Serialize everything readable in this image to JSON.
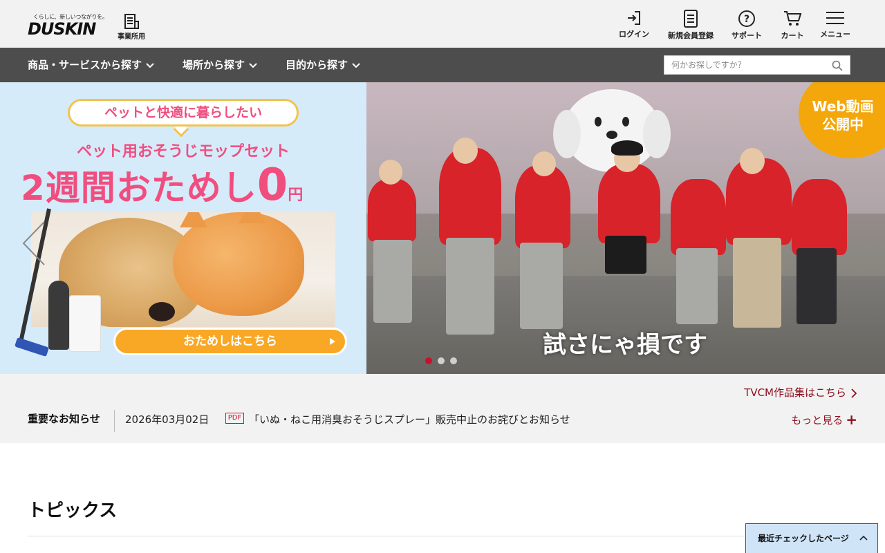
{
  "header": {
    "logo_tagline": "くらしに、新しいつながりを。",
    "logo_word": "DUSKIN",
    "business_label": "事業所用",
    "utility": [
      {
        "label": "ログイン",
        "icon": "login-icon"
      },
      {
        "label": "新規会員登録",
        "icon": "register-icon"
      },
      {
        "label": "サポート",
        "icon": "help-icon"
      },
      {
        "label": "カート",
        "icon": "cart-icon"
      },
      {
        "label": "メニュー",
        "icon": "menu-icon"
      }
    ]
  },
  "nav": {
    "items": [
      {
        "label": "商品・サービスから探す"
      },
      {
        "label": "場所から探す"
      },
      {
        "label": "目的から探す"
      }
    ],
    "search_placeholder": "何かお探しですか？"
  },
  "hero": {
    "promo": {
      "bubble": "ペットと快適に暮らしたい",
      "subtitle": "ペット用おそうじモップセット",
      "headline": "2週間おためし",
      "headline_zero": "0",
      "headline_yen": "円",
      "cta": "おためしはこちら"
    },
    "video": {
      "caption": "試さにゃ損です",
      "badge_line1": "Web動画",
      "badge_line2": "公開中"
    },
    "active_slide": 1,
    "slide_count": 3
  },
  "notice": {
    "tvcm_link": "TVCM作品集はこちら",
    "label": "重要なお知らせ",
    "date": "2026年03月02日",
    "pdf": "PDF",
    "title": "「いぬ・ねこ用消臭おそうじスプレー」販売中止のお詫びとお知らせ",
    "more": "もっと見る",
    "more_plus": "+"
  },
  "topics": {
    "title": "トピックス"
  },
  "recent": {
    "label": "最近チェックしたページ"
  },
  "colors": {
    "nav_bg": "#4d4d4d",
    "header_bg": "#f2f2f2",
    "promo_pink": "#f04e7f",
    "cta_orange": "#f9a825",
    "link_red": "#8b0f1d",
    "recent_bg": "#cfe4f7"
  }
}
